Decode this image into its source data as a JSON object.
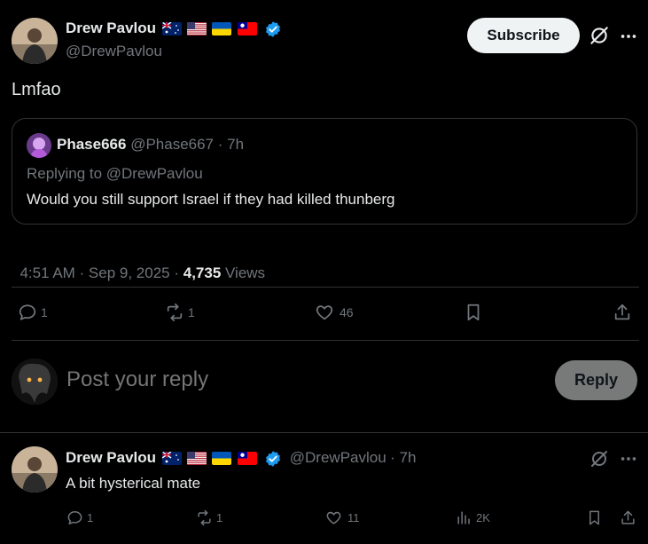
{
  "post": {
    "author_name": "Drew Pavlou",
    "author_handle": "@DrewPavlou",
    "subscribe_label": "Subscribe",
    "text": "Lmfao",
    "timestamp": "4:51 AM · Sep 9, 2025 · ",
    "views_count": "4,735",
    "views_label": " Views",
    "flags": [
      "australia-flag",
      "usa-flag",
      "ukraine-flag",
      "taiwan-flag"
    ]
  },
  "quote": {
    "author_name": "Phase666",
    "author_handle": "@Phase667",
    "time": "· 7h",
    "replying_to": "Replying to @DrewPavlou",
    "text": "Would you still support Israel if they had killed thunberg"
  },
  "actions": {
    "replies": "1",
    "reposts": "1",
    "likes": "46"
  },
  "composer": {
    "placeholder": "Post your reply",
    "reply_button": "Reply"
  },
  "reply": {
    "author_name": "Drew Pavlou",
    "author_handle": "@DrewPavlou",
    "time": "· 7h",
    "text": "A bit hysterical mate",
    "replies": "1",
    "reposts": "1",
    "likes": "11",
    "views": "2K"
  },
  "colors": {
    "background": "#000000",
    "text": "#e7e9ea",
    "secondary": "#71767b",
    "border": "#2f3336",
    "verified": "#1d9bf0"
  }
}
